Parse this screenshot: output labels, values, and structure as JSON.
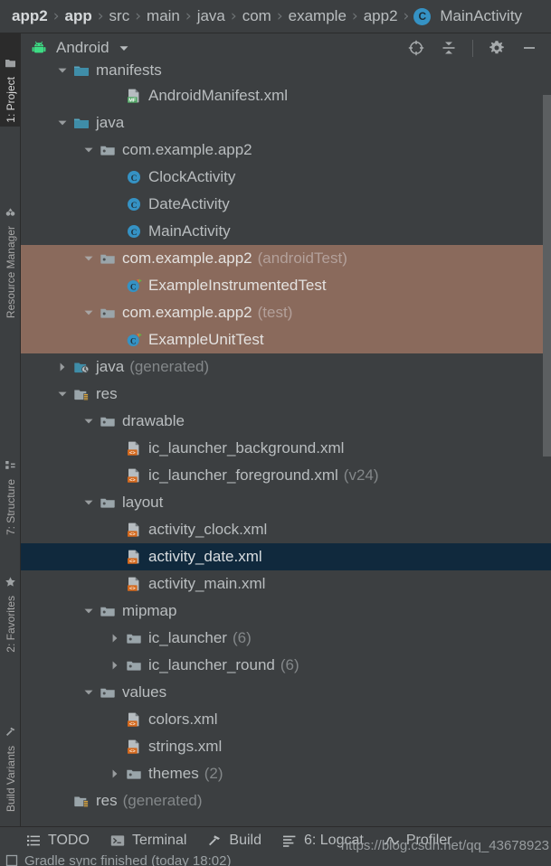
{
  "breadcrumb": {
    "separator": "›",
    "items": [
      {
        "label": "app2",
        "bold": true,
        "icon": null
      },
      {
        "label": "app",
        "bold": true,
        "icon": null
      },
      {
        "label": "src",
        "bold": false,
        "icon": null
      },
      {
        "label": "main",
        "bold": false,
        "icon": null
      },
      {
        "label": "java",
        "bold": false,
        "icon": null
      },
      {
        "label": "com",
        "bold": false,
        "icon": null
      },
      {
        "label": "example",
        "bold": false,
        "icon": null
      },
      {
        "label": "app2",
        "bold": false,
        "icon": null
      },
      {
        "label": "MainActivity",
        "bold": false,
        "icon": "class-icon",
        "icon_letter": "C"
      }
    ]
  },
  "left_tool_tabs": [
    {
      "label": "1: Project",
      "icon": "project-icon",
      "active": true
    },
    {
      "label": "Resource Manager",
      "icon": "resource-icon",
      "active": false
    },
    {
      "label": "7: Structure",
      "icon": "structure-icon",
      "active": false
    },
    {
      "label": "2: Favorites",
      "icon": "star-icon",
      "active": false
    },
    {
      "label": "Build Variants",
      "icon": "variants-icon",
      "active": false
    }
  ],
  "project_panel": {
    "title": "Android",
    "logo_icon": "android-robot-icon",
    "dropdown_icon": "chevron-down-icon",
    "toolbar_icons": [
      {
        "name": "select-opened-file-icon",
        "tooltip": "Select Opened File"
      },
      {
        "name": "collapse-all-icon",
        "tooltip": "Collapse All"
      },
      {
        "name": "settings-gear-icon",
        "tooltip": "Settings"
      },
      {
        "name": "hide-panel-icon",
        "tooltip": "Hide"
      }
    ]
  },
  "tree": [
    {
      "label": "manifests",
      "suffix": "",
      "depth": 1,
      "arrow": "down",
      "icon": "folder-teal-icon",
      "state": "normal",
      "clipped": true
    },
    {
      "label": "AndroidManifest.xml",
      "suffix": "",
      "depth": 3,
      "arrow": "none",
      "icon": "manifest-file-icon",
      "state": "normal"
    },
    {
      "label": "java",
      "suffix": "",
      "depth": 1,
      "arrow": "down",
      "icon": "folder-teal-icon",
      "state": "normal"
    },
    {
      "label": "com.example.app2",
      "suffix": "",
      "depth": 2,
      "arrow": "down",
      "icon": "package-icon",
      "state": "normal"
    },
    {
      "label": "ClockActivity",
      "suffix": "",
      "depth": 3,
      "arrow": "none",
      "icon": "class-icon",
      "state": "normal"
    },
    {
      "label": "DateActivity",
      "suffix": "",
      "depth": 3,
      "arrow": "none",
      "icon": "class-icon",
      "state": "normal"
    },
    {
      "label": "MainActivity",
      "suffix": "",
      "depth": 3,
      "arrow": "none",
      "icon": "class-icon",
      "state": "normal"
    },
    {
      "label": "com.example.app2",
      "suffix": "(androidTest)",
      "depth": 2,
      "arrow": "down",
      "icon": "package-icon",
      "state": "highlighted"
    },
    {
      "label": "ExampleInstrumentedTest",
      "suffix": "",
      "depth": 3,
      "arrow": "none",
      "icon": "test-class-icon",
      "state": "highlighted"
    },
    {
      "label": "com.example.app2",
      "suffix": "(test)",
      "depth": 2,
      "arrow": "down",
      "icon": "package-icon",
      "state": "highlighted"
    },
    {
      "label": "ExampleUnitTest",
      "suffix": "",
      "depth": 3,
      "arrow": "none",
      "icon": "test-class-icon",
      "state": "highlighted"
    },
    {
      "label": "java",
      "suffix": "(generated)",
      "depth": 1,
      "arrow": "right",
      "icon": "folder-generated-icon",
      "state": "normal"
    },
    {
      "label": "res",
      "suffix": "",
      "depth": 1,
      "arrow": "down",
      "icon": "res-folder-icon",
      "state": "normal"
    },
    {
      "label": "drawable",
      "suffix": "",
      "depth": 2,
      "arrow": "down",
      "icon": "package-icon",
      "state": "normal"
    },
    {
      "label": "ic_launcher_background.xml",
      "suffix": "",
      "depth": 3,
      "arrow": "none",
      "icon": "xml-file-icon",
      "state": "normal"
    },
    {
      "label": "ic_launcher_foreground.xml",
      "suffix": "(v24)",
      "depth": 3,
      "arrow": "none",
      "icon": "xml-file-icon",
      "state": "normal"
    },
    {
      "label": "layout",
      "suffix": "",
      "depth": 2,
      "arrow": "down",
      "icon": "package-icon",
      "state": "normal"
    },
    {
      "label": "activity_clock.xml",
      "suffix": "",
      "depth": 3,
      "arrow": "none",
      "icon": "xml-file-icon",
      "state": "normal"
    },
    {
      "label": "activity_date.xml",
      "suffix": "",
      "depth": 3,
      "arrow": "none",
      "icon": "xml-file-icon",
      "state": "selected"
    },
    {
      "label": "activity_main.xml",
      "suffix": "",
      "depth": 3,
      "arrow": "none",
      "icon": "xml-file-icon",
      "state": "normal"
    },
    {
      "label": "mipmap",
      "suffix": "",
      "depth": 2,
      "arrow": "down",
      "icon": "package-icon",
      "state": "normal"
    },
    {
      "label": "ic_launcher",
      "suffix": "(6)",
      "depth": 3,
      "arrow": "right",
      "icon": "package-icon",
      "state": "normal"
    },
    {
      "label": "ic_launcher_round",
      "suffix": "(6)",
      "depth": 3,
      "arrow": "right",
      "icon": "package-icon",
      "state": "normal"
    },
    {
      "label": "values",
      "suffix": "",
      "depth": 2,
      "arrow": "down",
      "icon": "package-icon",
      "state": "normal"
    },
    {
      "label": "colors.xml",
      "suffix": "",
      "depth": 3,
      "arrow": "none",
      "icon": "xml-file-icon",
      "state": "normal"
    },
    {
      "label": "strings.xml",
      "suffix": "",
      "depth": 3,
      "arrow": "none",
      "icon": "xml-file-icon",
      "state": "normal"
    },
    {
      "label": "themes",
      "suffix": "(2)",
      "depth": 3,
      "arrow": "right",
      "icon": "package-icon",
      "state": "normal"
    },
    {
      "label": "res",
      "suffix": "(generated)",
      "depth": 1,
      "arrow": "none",
      "icon": "res-folder-icon",
      "state": "normal"
    }
  ],
  "bottom_bar": {
    "tabs": [
      {
        "label": "TODO",
        "icon": "todo-icon"
      },
      {
        "label": "Terminal",
        "icon": "terminal-icon"
      },
      {
        "label": "Build",
        "icon": "build-hammer-icon"
      },
      {
        "label": "6: Logcat",
        "icon": "logcat-icon"
      },
      {
        "label": "Profiler",
        "icon": "profiler-icon"
      }
    ],
    "status_text": "Gradle sync finished (today 18:02)",
    "status_icon": "checkbox-icon",
    "watermark": "https://blog.csdn.net/qq_43678923"
  },
  "colors": {
    "panel_background": "#3c3f41",
    "selection_navy": "#10293d",
    "highlight_brown": "#8a6a5c",
    "text_primary": "#b9bdbf",
    "text_muted": "#838789",
    "accent_teal": "#3592c4",
    "accent_orange": "#d4691e",
    "android_green": "#3ddc84",
    "border": "#2b2b2b"
  }
}
